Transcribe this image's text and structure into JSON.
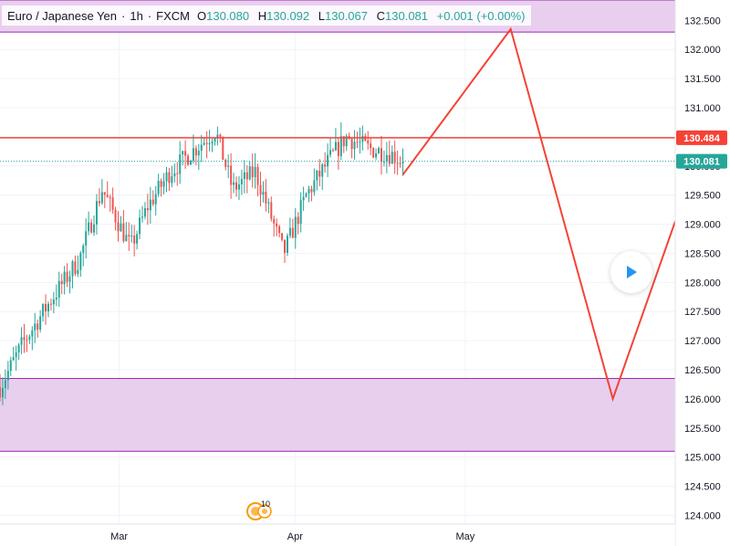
{
  "legend": {
    "symbol": "Euro / Japanese Yen",
    "interval": "1h",
    "source": "FXCM",
    "open_label": "O",
    "open": "130.080",
    "high_label": "H",
    "high": "130.092",
    "low_label": "L",
    "low": "130.067",
    "close_label": "C",
    "close": "130.081",
    "change": "+0.001 (+0.00%)"
  },
  "events_badge": "10",
  "colors": {
    "up": "#26a69a",
    "down": "#ef5350",
    "zone_fill": "#e8cfee",
    "zone_border": "#9c27b0",
    "path_line": "#f44336",
    "price_line": "#26a69a",
    "play_icon": "#2196f3"
  },
  "icons": {
    "play": "play-icon",
    "events": "events-icon"
  },
  "chart_data": {
    "type": "candlestick",
    "y_axis": {
      "min": 123.85,
      "max": 132.85,
      "ticks": [
        124.0,
        124.5,
        125.0,
        125.5,
        126.0,
        126.5,
        127.0,
        127.5,
        128.0,
        128.5,
        129.0,
        129.5,
        130.0,
        130.5,
        131.0,
        131.5,
        132.0,
        132.5
      ],
      "tick_labels": [
        "124.000",
        "124.500",
        "125.000",
        "125.500",
        "126.000",
        "126.500",
        "127.000",
        "127.500",
        "128.000",
        "128.500",
        "129.000",
        "129.500",
        "130.000",
        "130.500",
        "131.000",
        "131.500",
        "132.000",
        "132.500"
      ],
      "position": "right"
    },
    "x_axis": {
      "tick_labels": [
        "Mar",
        "Apr",
        "May"
      ],
      "tick_dates": [
        "2021-03-01",
        "2021-04-01",
        "2021-05-01"
      ],
      "range": [
        "2021-02-08",
        "2021-06-07"
      ]
    },
    "price_summary": {
      "start_date": "2021-02-08",
      "start_price": 126.2,
      "end_date": "2021-04-20",
      "end_price": 130.081,
      "period_high": 131.0,
      "approx_path": [
        [
          "2021-02-08",
          126.2
        ],
        [
          "2021-02-12",
          126.95
        ],
        [
          "2021-02-17",
          127.7
        ],
        [
          "2021-02-22",
          128.4
        ],
        [
          "2021-02-26",
          129.6
        ],
        [
          "2021-03-03",
          128.6
        ],
        [
          "2021-03-06",
          129.3
        ],
        [
          "2021-03-10",
          129.9
        ],
        [
          "2021-03-15",
          130.35
        ],
        [
          "2021-03-18",
          130.6
        ],
        [
          "2021-03-21",
          129.6
        ],
        [
          "2021-03-25",
          129.9
        ],
        [
          "2021-03-30",
          128.5
        ],
        [
          "2021-04-03",
          129.5
        ],
        [
          "2021-04-07",
          130.1
        ],
        [
          "2021-04-10",
          130.5
        ],
        [
          "2021-04-14",
          130.3
        ],
        [
          "2021-04-18",
          130.2
        ],
        [
          "2021-04-20",
          130.081
        ]
      ]
    },
    "horizontal_lines": [
      {
        "name": "resistance",
        "price": 130.484,
        "label": "130.484",
        "color": "#f44336"
      },
      {
        "name": "last-price",
        "price": 130.081,
        "label": "130.081",
        "color": "#26a69a",
        "style": "dotted"
      }
    ],
    "zones": [
      {
        "name": "upper-zone",
        "from": 132.3,
        "to": 132.85
      },
      {
        "name": "lower-zone",
        "from": 125.1,
        "to": 126.35
      }
    ],
    "projection_path": [
      {
        "date": "2021-04-20",
        "price": 129.85
      },
      {
        "date": "2021-05-09",
        "price": 132.35
      },
      {
        "date": "2021-05-27",
        "price": 126.0
      },
      {
        "date": "2021-06-07",
        "price": 129.05
      }
    ],
    "grid": true
  }
}
